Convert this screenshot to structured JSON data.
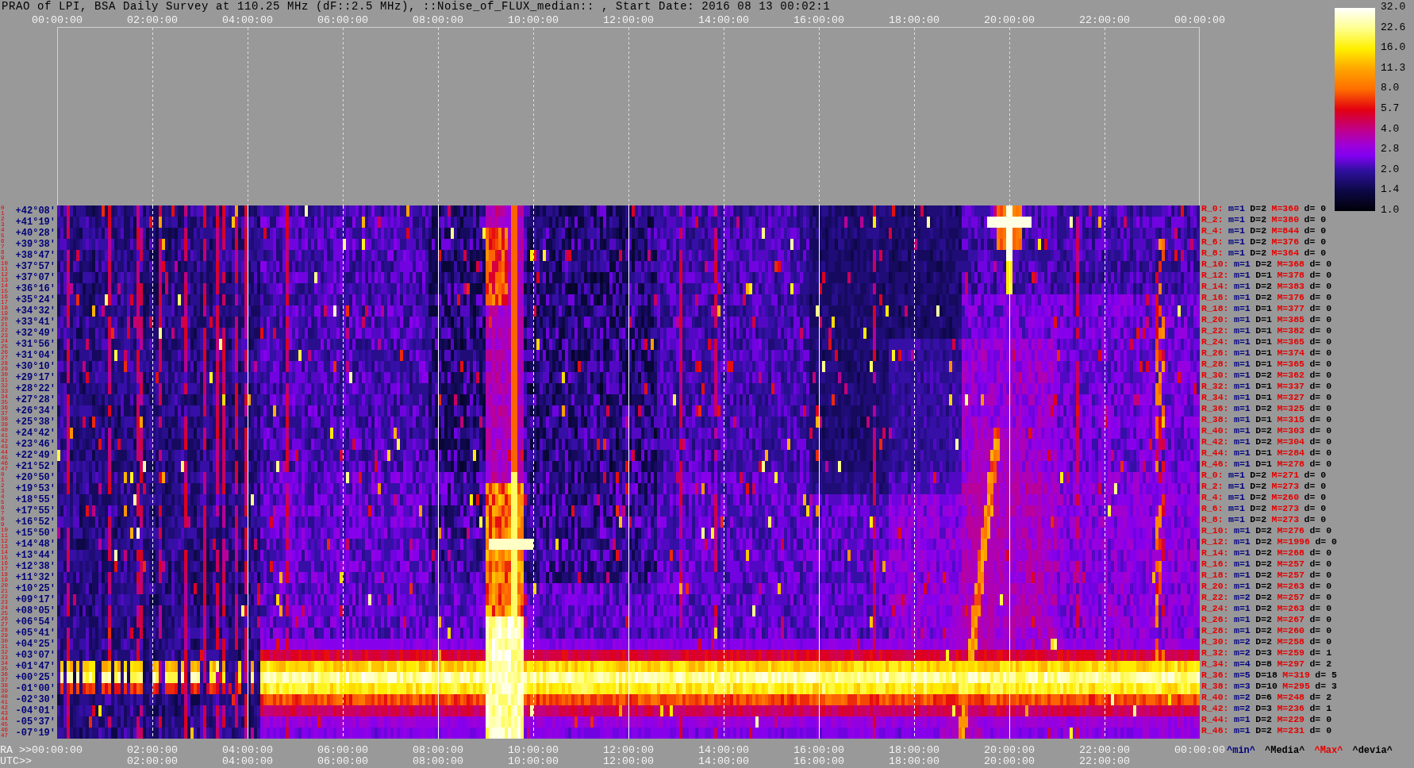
{
  "title": "PRAO of LPI, BSA Daily Survey at 110.25 MHz (dF::2.5 MHz), ::Noise_of_FLUX_median:: , Start Date: 2016 08 13 00:02:1",
  "color_scale": {
    "labels": [
      "32.0",
      "22.6",
      "16.0",
      "11.3",
      "8.0",
      "5.7",
      "4.0",
      "2.8",
      "2.0",
      "1.4",
      "1.0"
    ]
  },
  "top_axis": {
    "ticks": [
      "00:00:00",
      "02:00:00",
      "04:00:00",
      "06:00:00",
      "08:00:00",
      "10:00:00",
      "12:00:00",
      "14:00:00",
      "16:00:00",
      "18:00:00",
      "20:00:00",
      "22:00:00",
      "00:00:00"
    ]
  },
  "rows": [
    {
      "index_marks": [
        "0",
        "1"
      ],
      "declination": "+42°08'",
      "stats": {
        "beam": "R_0:",
        "min": "m=1",
        "median": "D=2",
        "max": "M=360",
        "deviation": "d= 0"
      }
    },
    {
      "index_marks": [
        "2",
        "3"
      ],
      "declination": "+41°19'",
      "stats": {
        "beam": "R_2:",
        "min": "m=1",
        "median": "D=2",
        "max": "M=380",
        "deviation": "d= 0"
      }
    },
    {
      "index_marks": [
        "4",
        "5"
      ],
      "declination": "+40°28'",
      "stats": {
        "beam": "R_4:",
        "min": "m=1",
        "median": "D=2",
        "max": "M=844",
        "deviation": "d= 0"
      }
    },
    {
      "index_marks": [
        "6",
        "7"
      ],
      "declination": "+39°38'",
      "stats": {
        "beam": "R_6:",
        "min": "m=1",
        "median": "D=2",
        "max": "M=376",
        "deviation": "d= 0"
      }
    },
    {
      "index_marks": [
        "8",
        "9"
      ],
      "declination": "+38°47'",
      "stats": {
        "beam": "R_8:",
        "min": "m=1",
        "median": "D=2",
        "max": "M=364",
        "deviation": "d= 0"
      }
    },
    {
      "index_marks": [
        "10",
        "11"
      ],
      "declination": "+37°57'",
      "stats": {
        "beam": "R_10:",
        "min": "m=1",
        "median": "D=2",
        "max": "M=368",
        "deviation": "d= 0"
      }
    },
    {
      "index_marks": [
        "12",
        "13"
      ],
      "declination": "+37°07'",
      "stats": {
        "beam": "R_12:",
        "min": "m=1",
        "median": "D=1",
        "max": "M=378",
        "deviation": "d= 0"
      }
    },
    {
      "index_marks": [
        "14",
        "15"
      ],
      "declination": "+36°16'",
      "stats": {
        "beam": "R_14:",
        "min": "m=1",
        "median": "D=2",
        "max": "M=383",
        "deviation": "d= 0"
      }
    },
    {
      "index_marks": [
        "16",
        "17"
      ],
      "declination": "+35°24'",
      "stats": {
        "beam": "R_16:",
        "min": "m=1",
        "median": "D=2",
        "max": "M=376",
        "deviation": "d= 0"
      }
    },
    {
      "index_marks": [
        "18",
        "19"
      ],
      "declination": "+34°32'",
      "stats": {
        "beam": "R_18:",
        "min": "m=1",
        "median": "D=1",
        "max": "M=377",
        "deviation": "d= 0"
      }
    },
    {
      "index_marks": [
        "20",
        "21"
      ],
      "declination": "+33°41'",
      "stats": {
        "beam": "R_20:",
        "min": "m=1",
        "median": "D=1",
        "max": "M=385",
        "deviation": "d= 0"
      }
    },
    {
      "index_marks": [
        "22",
        "23"
      ],
      "declination": "+32°49'",
      "stats": {
        "beam": "R_22:",
        "min": "m=1",
        "median": "D=1",
        "max": "M=382",
        "deviation": "d= 0"
      }
    },
    {
      "index_marks": [
        "24",
        "25"
      ],
      "declination": "+31°56'",
      "stats": {
        "beam": "R_24:",
        "min": "m=1",
        "median": "D=1",
        "max": "M=365",
        "deviation": "d= 0"
      }
    },
    {
      "index_marks": [
        "26",
        "27"
      ],
      "declination": "+31°04'",
      "stats": {
        "beam": "R_26:",
        "min": "m=1",
        "median": "D=1",
        "max": "M=374",
        "deviation": "d= 0"
      }
    },
    {
      "index_marks": [
        "28",
        "29"
      ],
      "declination": "+30°10'",
      "stats": {
        "beam": "R_28:",
        "min": "m=1",
        "median": "D=1",
        "max": "M=365",
        "deviation": "d= 0"
      }
    },
    {
      "index_marks": [
        "30",
        "31"
      ],
      "declination": "+29°17'",
      "stats": {
        "beam": "R_30:",
        "min": "m=1",
        "median": "D=2",
        "max": "M=362",
        "deviation": "d= 0"
      }
    },
    {
      "index_marks": [
        "32",
        "33"
      ],
      "declination": "+28°22'",
      "stats": {
        "beam": "R_32:",
        "min": "m=1",
        "median": "D=1",
        "max": "M=337",
        "deviation": "d= 0"
      }
    },
    {
      "index_marks": [
        "34",
        "35"
      ],
      "declination": "+27°28'",
      "stats": {
        "beam": "R_34:",
        "min": "m=1",
        "median": "D=1",
        "max": "M=327",
        "deviation": "d= 0"
      }
    },
    {
      "index_marks": [
        "36",
        "37"
      ],
      "declination": "+26°34'",
      "stats": {
        "beam": "R_36:",
        "min": "m=1",
        "median": "D=2",
        "max": "M=325",
        "deviation": "d= 0"
      }
    },
    {
      "index_marks": [
        "38",
        "39"
      ],
      "declination": "+25°38'",
      "stats": {
        "beam": "R_38:",
        "min": "m=1",
        "median": "D=1",
        "max": "M=315",
        "deviation": "d= 0"
      }
    },
    {
      "index_marks": [
        "40",
        "41"
      ],
      "declination": "+24°42'",
      "stats": {
        "beam": "R_40:",
        "min": "m=1",
        "median": "D=2",
        "max": "M=303",
        "deviation": "d= 0"
      }
    },
    {
      "index_marks": [
        "42",
        "43"
      ],
      "declination": "+23°46'",
      "stats": {
        "beam": "R_42:",
        "min": "m=1",
        "median": "D=2",
        "max": "M=304",
        "deviation": "d= 0"
      }
    },
    {
      "index_marks": [
        "44",
        "45"
      ],
      "declination": "+22°49'",
      "stats": {
        "beam": "R_44:",
        "min": "m=1",
        "median": "D=1",
        "max": "M=284",
        "deviation": "d= 0"
      }
    },
    {
      "index_marks": [
        "46",
        "47"
      ],
      "declination": "+21°52'",
      "stats": {
        "beam": "R_46:",
        "min": "m=1",
        "median": "D=1",
        "max": "M=278",
        "deviation": "d= 0"
      }
    },
    {
      "index_marks": [
        "0",
        "1"
      ],
      "declination": "+20°50'",
      "stats": {
        "beam": "R_0:",
        "min": "m=1",
        "median": "D=2",
        "max": "M=271",
        "deviation": "d= 0"
      }
    },
    {
      "index_marks": [
        "2",
        "3"
      ],
      "declination": "+19°53'",
      "stats": {
        "beam": "R_2:",
        "min": "m=1",
        "median": "D=2",
        "max": "M=273",
        "deviation": "d= 0"
      }
    },
    {
      "index_marks": [
        "4",
        "5"
      ],
      "declination": "+18°55'",
      "stats": {
        "beam": "R_4:",
        "min": "m=1",
        "median": "D=2",
        "max": "M=260",
        "deviation": "d= 0"
      }
    },
    {
      "index_marks": [
        "6",
        "7"
      ],
      "declination": "+17°55'",
      "stats": {
        "beam": "R_6:",
        "min": "m=1",
        "median": "D=2",
        "max": "M=273",
        "deviation": "d= 0"
      }
    },
    {
      "index_marks": [
        "8",
        "9"
      ],
      "declination": "+16°52'",
      "stats": {
        "beam": "R_8:",
        "min": "m=1",
        "median": "D=2",
        "max": "M=273",
        "deviation": "d= 0"
      }
    },
    {
      "index_marks": [
        "10",
        "11"
      ],
      "declination": "+15°50'",
      "stats": {
        "beam": "R_10:",
        "min": "m=1",
        "median": "D=2",
        "max": "M=276",
        "deviation": "d= 0"
      }
    },
    {
      "index_marks": [
        "12",
        "13"
      ],
      "declination": "+14°48'",
      "stats": {
        "beam": "R_12:",
        "min": "m=1",
        "median": "D=2",
        "max": "M=1996",
        "deviation": "d= 0"
      }
    },
    {
      "index_marks": [
        "14",
        "15"
      ],
      "declination": "+13°44'",
      "stats": {
        "beam": "R_14:",
        "min": "m=1",
        "median": "D=2",
        "max": "M=268",
        "deviation": "d= 0"
      }
    },
    {
      "index_marks": [
        "16",
        "17"
      ],
      "declination": "+12°38'",
      "stats": {
        "beam": "R_16:",
        "min": "m=1",
        "median": "D=2",
        "max": "M=257",
        "deviation": "d= 0"
      }
    },
    {
      "index_marks": [
        "18",
        "19"
      ],
      "declination": "+11°32'",
      "stats": {
        "beam": "R_18:",
        "min": "m=1",
        "median": "D=2",
        "max": "M=257",
        "deviation": "d= 0"
      }
    },
    {
      "index_marks": [
        "20",
        "21"
      ],
      "declination": "+10°25'",
      "stats": {
        "beam": "R_20:",
        "min": "m=1",
        "median": "D=2",
        "max": "M=263",
        "deviation": "d= 0"
      }
    },
    {
      "index_marks": [
        "22",
        "23"
      ],
      "declination": "+09°17'",
      "stats": {
        "beam": "R_22:",
        "min": "m=2",
        "median": "D=2",
        "max": "M=257",
        "deviation": "d= 0"
      }
    },
    {
      "index_marks": [
        "24",
        "25"
      ],
      "declination": "+08°05'",
      "stats": {
        "beam": "R_24:",
        "min": "m=1",
        "median": "D=2",
        "max": "M=263",
        "deviation": "d= 0"
      }
    },
    {
      "index_marks": [
        "26",
        "27"
      ],
      "declination": "+06°54'",
      "stats": {
        "beam": "R_26:",
        "min": "m=1",
        "median": "D=2",
        "max": "M=267",
        "deviation": "d= 0"
      }
    },
    {
      "index_marks": [
        "28",
        "29"
      ],
      "declination": "+05°41'",
      "stats": {
        "beam": "R_28:",
        "min": "m=1",
        "median": "D=2",
        "max": "M=260",
        "deviation": "d= 0"
      }
    },
    {
      "index_marks": [
        "30",
        "31"
      ],
      "declination": "+04°25'",
      "stats": {
        "beam": "R_30:",
        "min": "m=2",
        "median": "D=2",
        "max": "M=258",
        "deviation": "d= 0"
      }
    },
    {
      "index_marks": [
        "32",
        "33"
      ],
      "declination": "+03°07'",
      "stats": {
        "beam": "R_32:",
        "min": "m=2",
        "median": "D=3",
        "max": "M=259",
        "deviation": "d= 1"
      }
    },
    {
      "index_marks": [
        "34",
        "35"
      ],
      "declination": "+01°47'",
      "stats": {
        "beam": "R_34:",
        "min": "m=4",
        "median": "D=8",
        "max": "M=297",
        "deviation": "d= 2"
      }
    },
    {
      "index_marks": [
        "36",
        "37"
      ],
      "declination": "+00°25'",
      "stats": {
        "beam": "R_36:",
        "min": "m=5",
        "median": "D=18",
        "max": "M=319",
        "deviation": "d= 5"
      }
    },
    {
      "index_marks": [
        "38",
        "39"
      ],
      "declination": "-01°00'",
      "stats": {
        "beam": "R_38:",
        "min": "m=3",
        "median": "D=10",
        "max": "M=295",
        "deviation": "d= 3"
      }
    },
    {
      "index_marks": [
        "40",
        "41"
      ],
      "declination": "-02°30'",
      "stats": {
        "beam": "R_40:",
        "min": "m=2",
        "median": "D=6",
        "max": "M=248",
        "deviation": "d= 2"
      }
    },
    {
      "index_marks": [
        "42",
        "43"
      ],
      "declination": "-04°01'",
      "stats": {
        "beam": "R_42:",
        "min": "m=2",
        "median": "D=3",
        "max": "M=236",
        "deviation": "d= 1"
      }
    },
    {
      "index_marks": [
        "44",
        "45"
      ],
      "declination": "-05°37'",
      "stats": {
        "beam": "R_44:",
        "min": "m=1",
        "median": "D=2",
        "max": "M=229",
        "deviation": "d= 0"
      }
    },
    {
      "index_marks": [
        "46",
        "47"
      ],
      "declination": "-07°19'",
      "stats": {
        "beam": "R_46:",
        "min": "m=1",
        "median": "D=2",
        "max": "M=231",
        "deviation": "d= 0"
      }
    }
  ],
  "bottom_axis": {
    "ra_prefix": "RA >>",
    "ra_ticks": [
      "00:00:00",
      "02:00:00",
      "04:00:00",
      "06:00:00",
      "08:00:00",
      "10:00:00",
      "12:00:00",
      "14:00:00",
      "16:00:00",
      "18:00:00",
      "20:00:00",
      "22:00:00",
      "00:00:00"
    ],
    "utc_prefix": "UTC>>",
    "utc_ticks": [
      "02:00:00",
      "04:00:00",
      "06:00:00",
      "08:00:00",
      "10:00:00",
      "12:00:00",
      "14:00:00",
      "16:00:00",
      "18:00:00",
      "20:00:00",
      "22:00:00"
    ]
  },
  "legend": [
    {
      "kind": "min",
      "text": "^min^"
    },
    {
      "kind": "median",
      "text": "^Media^"
    },
    {
      "kind": "max",
      "text": "^Max^"
    },
    {
      "kind": "deviation",
      "text": "^devia^"
    }
  ]
}
